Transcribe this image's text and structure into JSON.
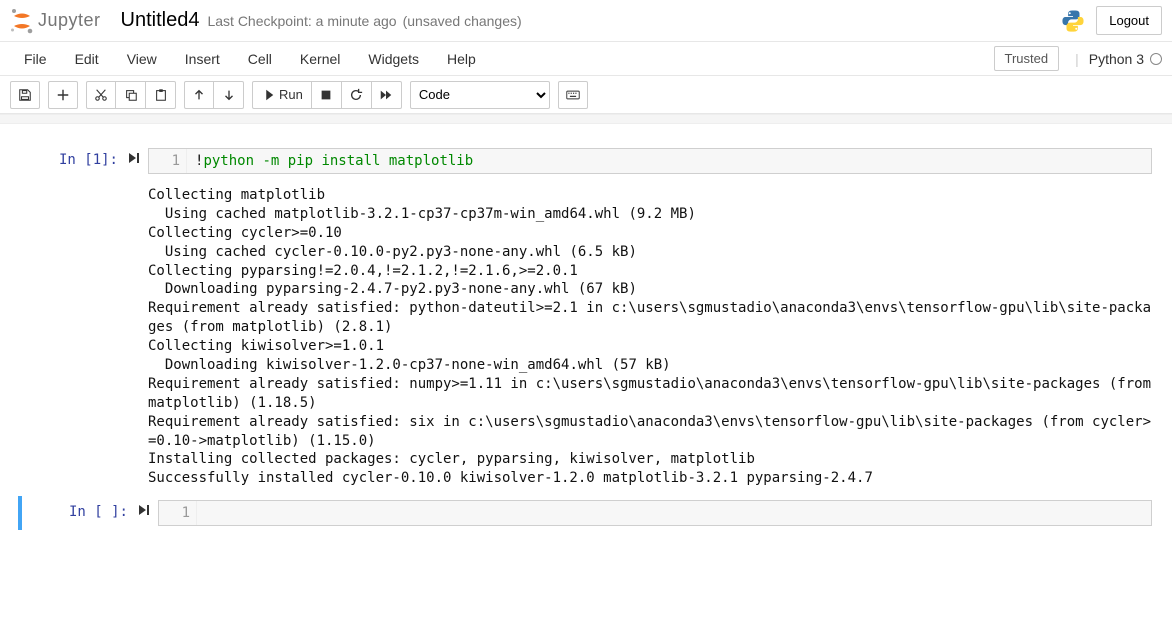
{
  "header": {
    "logo_text": "Jupyter",
    "title": "Untitled4",
    "checkpoint": "Last Checkpoint: a minute ago",
    "unsaved": "(unsaved changes)",
    "logout": "Logout"
  },
  "menu": {
    "items": [
      "File",
      "Edit",
      "View",
      "Insert",
      "Cell",
      "Kernel",
      "Widgets",
      "Help"
    ],
    "trusted": "Trusted",
    "kernel": "Python 3"
  },
  "toolbar": {
    "run_label": "Run",
    "celltype": "Code"
  },
  "cells": [
    {
      "prompt": "In [1]:",
      "line_no": "1",
      "code_prefix": "!",
      "code_rest": "python -m pip install matplotlib",
      "output": "Collecting matplotlib\n  Using cached matplotlib-3.2.1-cp37-cp37m-win_amd64.whl (9.2 MB)\nCollecting cycler>=0.10\n  Using cached cycler-0.10.0-py2.py3-none-any.whl (6.5 kB)\nCollecting pyparsing!=2.0.4,!=2.1.2,!=2.1.6,>=2.0.1\n  Downloading pyparsing-2.4.7-py2.py3-none-any.whl (67 kB)\nRequirement already satisfied: python-dateutil>=2.1 in c:\\users\\sgmustadio\\anaconda3\\envs\\tensorflow-gpu\\lib\\site-packages (from matplotlib) (2.8.1)\nCollecting kiwisolver>=1.0.1\n  Downloading kiwisolver-1.2.0-cp37-none-win_amd64.whl (57 kB)\nRequirement already satisfied: numpy>=1.11 in c:\\users\\sgmustadio\\anaconda3\\envs\\tensorflow-gpu\\lib\\site-packages (from matplotlib) (1.18.5)\nRequirement already satisfied: six in c:\\users\\sgmustadio\\anaconda3\\envs\\tensorflow-gpu\\lib\\site-packages (from cycler>=0.10->matplotlib) (1.15.0)\nInstalling collected packages: cycler, pyparsing, kiwisolver, matplotlib\nSuccessfully installed cycler-0.10.0 kiwisolver-1.2.0 matplotlib-3.2.1 pyparsing-2.4.7"
    },
    {
      "prompt": "In [ ]:",
      "line_no": "1",
      "code_prefix": "",
      "code_rest": ""
    }
  ]
}
